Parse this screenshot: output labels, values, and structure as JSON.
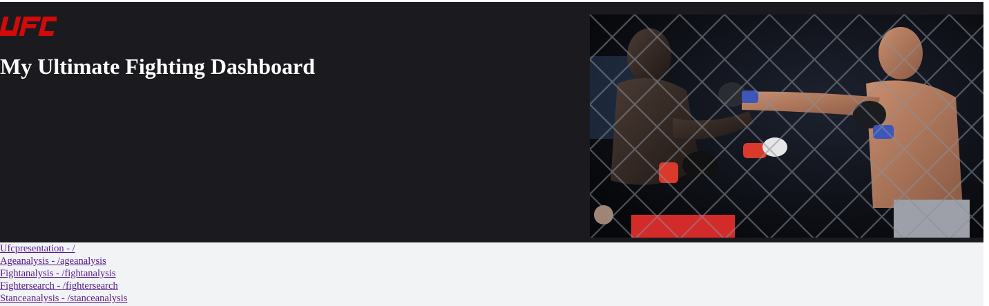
{
  "header": {
    "logo_text": "UFC",
    "title": "My Ultimate Fighting Dashboard",
    "brand_color": "#d20a0a",
    "background": "#1b1b1f"
  },
  "hero": {
    "icon": "fight-photo-image"
  },
  "nav": {
    "links": [
      {
        "label": "Ufcpresentation - /"
      },
      {
        "label": "Ageanalysis - /ageanalysis"
      },
      {
        "label": "Fightanalysis - /fightanalysis"
      },
      {
        "label": "Fightersearch - /fightersearch"
      },
      {
        "label": "Stanceanalysis - /stanceanalysis"
      }
    ],
    "link_color": "#551a8b",
    "background": "#f2f3f5"
  }
}
